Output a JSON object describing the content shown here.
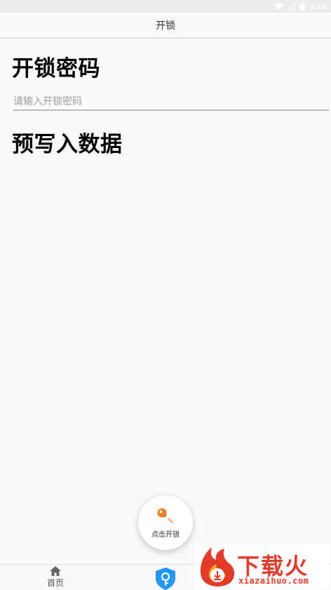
{
  "status_bar": {
    "time": "3:16"
  },
  "app_bar": {
    "title": "开锁"
  },
  "password_section": {
    "title": "开锁密码",
    "input": {
      "placeholder": "请输入开锁密码",
      "value": ""
    }
  },
  "data_section": {
    "title": "预写入数据"
  },
  "fab": {
    "label": "点击开锁",
    "icon": "key-icon"
  },
  "bottom_nav": {
    "items": [
      {
        "label": "首页",
        "icon": "home-icon"
      },
      {
        "label": "",
        "icon": "shield-key-icon"
      }
    ]
  },
  "watermark": {
    "text": "下载火",
    "domain": "xiazaihuo.com"
  },
  "colors": {
    "accent_blue": "#2196f3",
    "key_orange": "#ef7d22",
    "watermark_red": "#e43a2a"
  }
}
